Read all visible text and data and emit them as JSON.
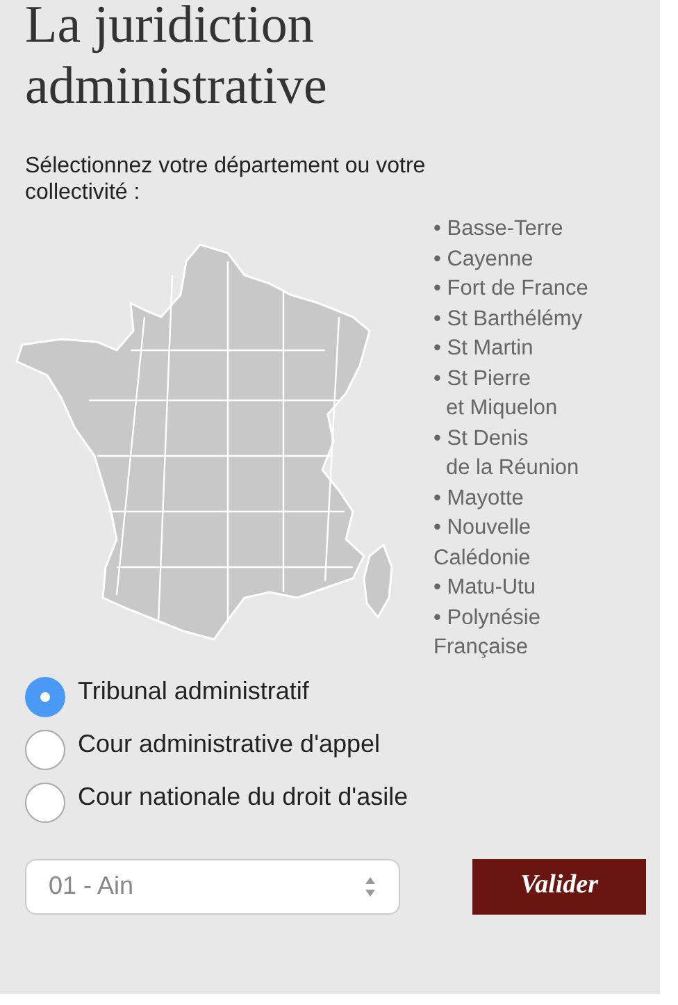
{
  "title": "La juridiction administrative",
  "prompt": "Sélectionnez votre département ou votre collectivité :",
  "territories": [
    {
      "lines": [
        "• Basse-Terre"
      ]
    },
    {
      "lines": [
        "• Cayenne"
      ]
    },
    {
      "lines": [
        "• Fort de France"
      ]
    },
    {
      "lines": [
        "• St Barthélémy"
      ]
    },
    {
      "lines": [
        "• St Martin"
      ]
    },
    {
      "lines": [
        "• St Pierre",
        "et Miquelon"
      ],
      "kind": "indented"
    },
    {
      "lines": [
        "• St Denis",
        "de la Réunion"
      ],
      "kind": "indented"
    },
    {
      "lines": [
        "• Mayotte"
      ]
    },
    {
      "lines": [
        "• Nouvelle",
        "Calédonie"
      ],
      "kind": "flush"
    },
    {
      "lines": [
        "• Matu-Utu"
      ]
    },
    {
      "lines": [
        "• Polynésie",
        "Française"
      ],
      "kind": "flush"
    }
  ],
  "courts": [
    {
      "label": "Tribunal administratif",
      "selected": true
    },
    {
      "label": "Cour administrative d'appel",
      "selected": false
    },
    {
      "label": "Cour nationale du droit d'asile",
      "selected": false
    }
  ],
  "department_select": {
    "value": "01 - Ain"
  },
  "submit_button": "Valider"
}
